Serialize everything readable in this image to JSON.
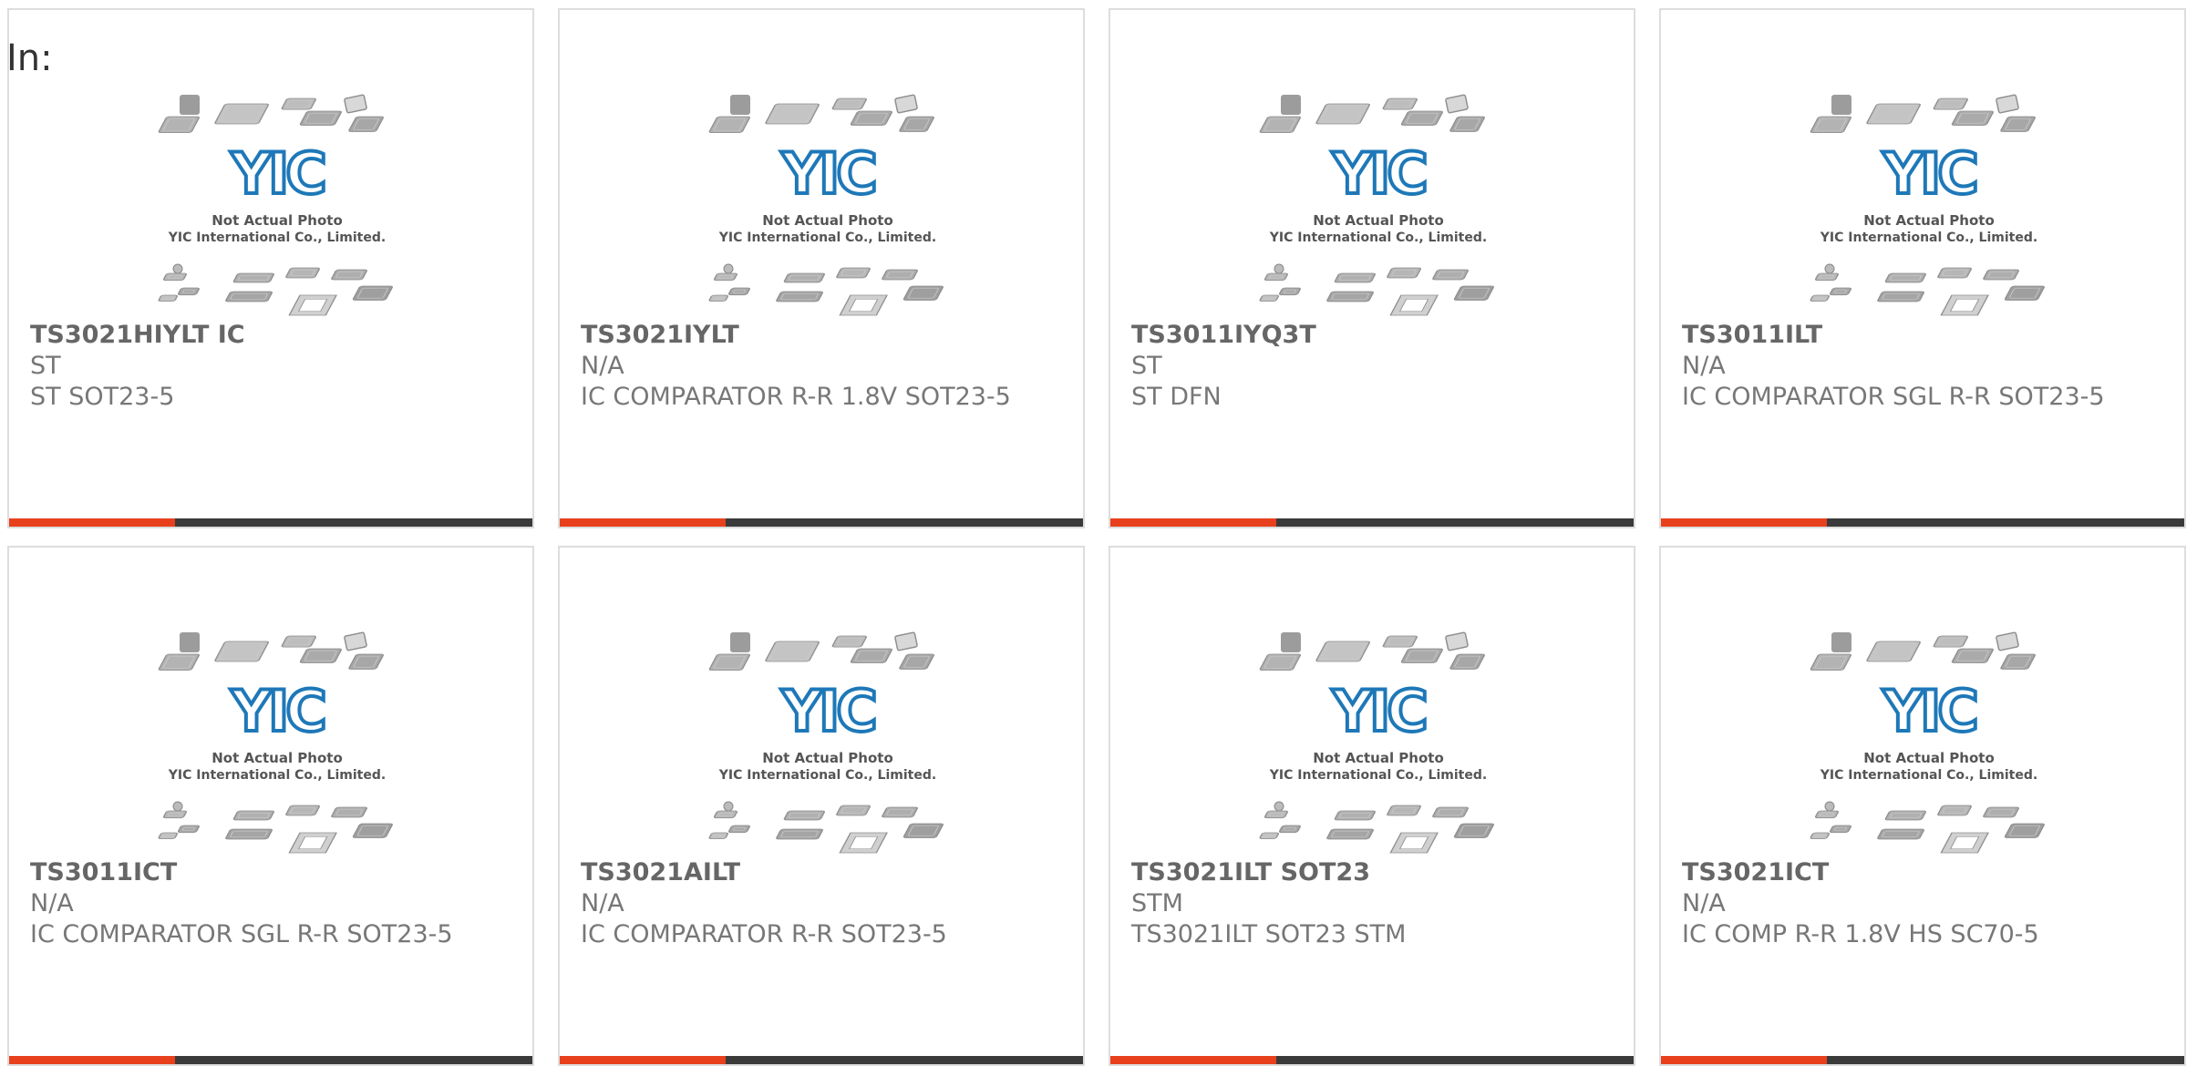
{
  "heading": "In:",
  "colors": {
    "accent_bar": "#e8401c",
    "dark_bar": "#3a3a3a",
    "logo_blue": "#1e78b8"
  },
  "placeholder_image": {
    "icon": "chip-packages-placeholder-icon",
    "logo_text": "YIC",
    "caption_line1": "Not Actual Photo",
    "caption_line2": "YIC International Co., Limited."
  },
  "products": [
    {
      "part": "TS3021HIYLT IC",
      "maker": "ST",
      "desc": "ST SOT23-5"
    },
    {
      "part": "TS3021IYLT",
      "maker": "N/A",
      "desc": "IC COMPARATOR R-R 1.8V SOT23-5"
    },
    {
      "part": "TS3011IYQ3T",
      "maker": "ST",
      "desc": "ST DFN"
    },
    {
      "part": "TS3011ILT",
      "maker": "N/A",
      "desc": "IC COMPARATOR SGL R-R SOT23-5"
    },
    {
      "part": "TS3011ICT",
      "maker": "N/A",
      "desc": "IC COMPARATOR SGL R-R SOT23-5"
    },
    {
      "part": "TS3021AILT",
      "maker": "N/A",
      "desc": "IC COMPARATOR R-R SOT23-5"
    },
    {
      "part": "TS3021ILT SOT23",
      "maker": "STM",
      "desc": "TS3021ILT SOT23 STM"
    },
    {
      "part": "TS3021ICT",
      "maker": "N/A",
      "desc": "IC COMP R-R 1.8V HS SC70-5"
    }
  ]
}
